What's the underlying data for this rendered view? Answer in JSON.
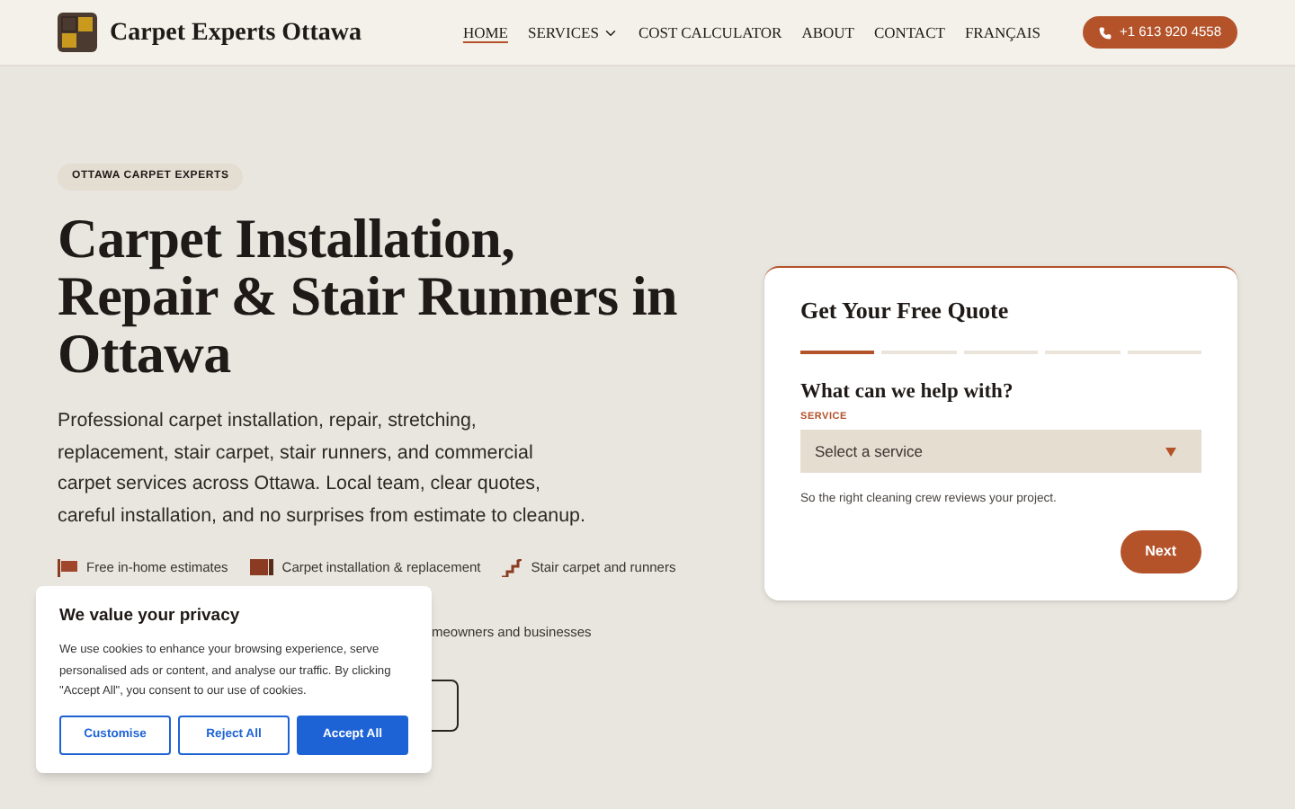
{
  "header": {
    "brand": "Carpet Experts Ottawa",
    "nav": [
      {
        "label": "HOME",
        "selected": true,
        "dropdown": false
      },
      {
        "label": "SERVICES",
        "selected": false,
        "dropdown": true
      },
      {
        "label": "COST CALCULATOR",
        "selected": false,
        "dropdown": false
      },
      {
        "label": "ABOUT",
        "selected": false,
        "dropdown": false
      },
      {
        "label": "CONTACT",
        "selected": false,
        "dropdown": false
      },
      {
        "label": "FRANÇAIS",
        "selected": false,
        "dropdown": false
      }
    ],
    "phone": "+1 613 920 4558"
  },
  "hero": {
    "eyebrow": "OTTAWA CARPET EXPERTS",
    "title_lines": [
      "Carpet Installation,",
      "Repair & Stair Runners in",
      "Ottawa"
    ],
    "lead": "Professional carpet installation, repair, stretching, replacement, stair carpet, stair runners, and commercial carpet services across Ottawa. Local team, clear quotes, careful installation, and no surprises from estimate to cleanup.",
    "features": [
      {
        "kind": "flag",
        "label": "Free in-home estimates"
      },
      {
        "kind": "roll",
        "label": "Carpet installation & replacement"
      },
      {
        "kind": "stairs",
        "label": "Stair carpet and runners"
      }
    ],
    "features_partial": "meowners and businesses"
  },
  "quote_form": {
    "title": "Get Your Free Quote",
    "steps": [
      {
        "active": true
      },
      {
        "active": false
      },
      {
        "active": false
      },
      {
        "active": false
      },
      {
        "active": false
      }
    ],
    "question": "What can we help with?",
    "field_label": "SERVICE",
    "select_placeholder": "Select a service",
    "hint": "So the right cleaning crew reviews your project.",
    "next": "Next"
  },
  "cookie_banner": {
    "title": "We value your privacy",
    "text": "We use cookies to enhance your browsing experience, serve personalised ads or content, and analyse our traffic. By clicking \"Accept All\", you consent to our use of cookies.",
    "buttons": [
      {
        "label": "Customise",
        "primary": false
      },
      {
        "label": "Reject All",
        "primary": false
      },
      {
        "label": "Accept All",
        "primary": true
      }
    ]
  }
}
